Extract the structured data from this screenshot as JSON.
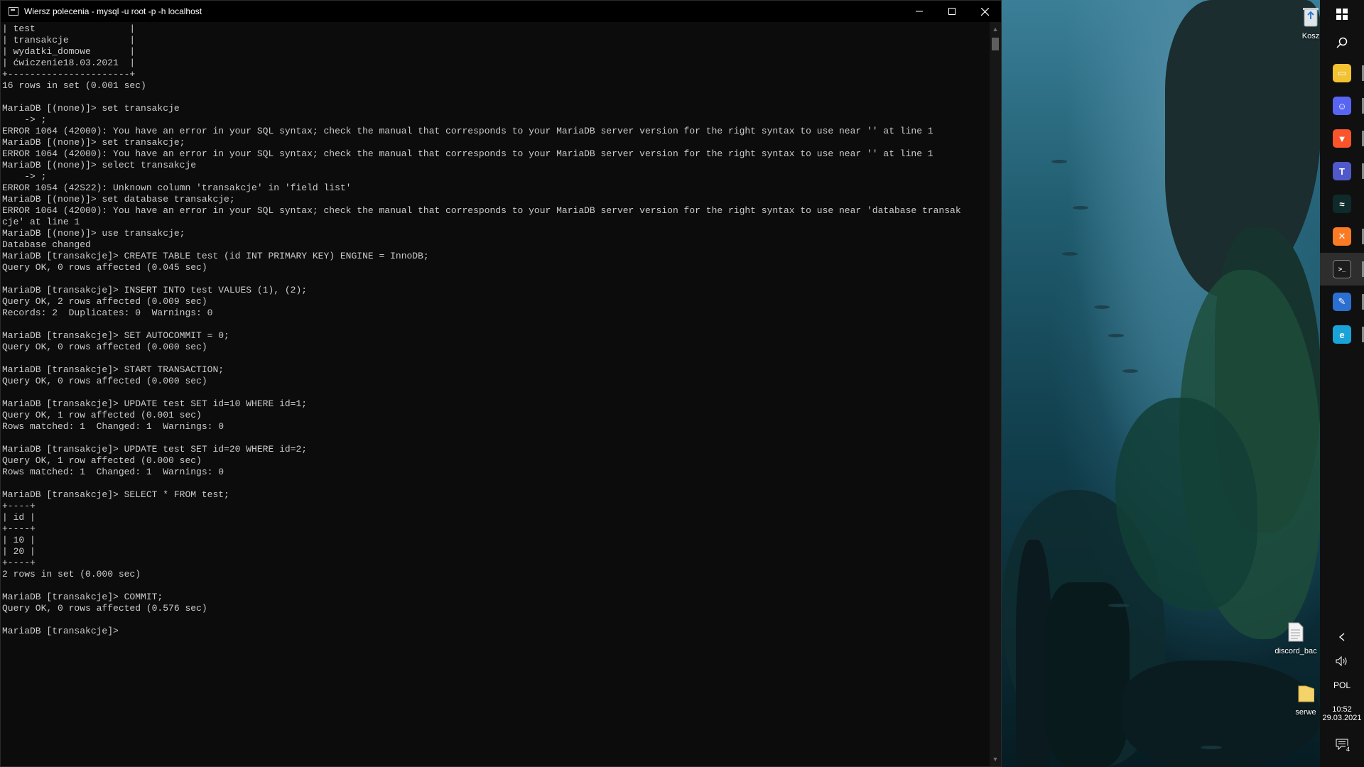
{
  "window": {
    "title": "Wiersz polecenia - mysql  -u root -p -h localhost",
    "minimize_icon": "minimize-icon",
    "maximize_icon": "maximize-icon",
    "close_icon": "close-icon"
  },
  "console": {
    "lines": [
      "| test                 |",
      "| transakcje           |",
      "| wydatki_domowe       |",
      "| ćwiczenie18.03.2021  |",
      "+----------------------+",
      "16 rows in set (0.001 sec)",
      "",
      "MariaDB [(none)]> set transakcje",
      "    -> ;",
      "ERROR 1064 (42000): You have an error in your SQL syntax; check the manual that corresponds to your MariaDB server version for the right syntax to use near '' at line 1",
      "MariaDB [(none)]> set transakcje;",
      "ERROR 1064 (42000): You have an error in your SQL syntax; check the manual that corresponds to your MariaDB server version for the right syntax to use near '' at line 1",
      "MariaDB [(none)]> select transakcje",
      "    -> ;",
      "ERROR 1054 (42S22): Unknown column 'transakcje' in 'field list'",
      "MariaDB [(none)]> set database transakcje;",
      "ERROR 1064 (42000): You have an error in your SQL syntax; check the manual that corresponds to your MariaDB server version for the right syntax to use near 'database transak",
      "cje' at line 1",
      "MariaDB [(none)]> use transakcje;",
      "Database changed",
      "MariaDB [transakcje]> CREATE TABLE test (id INT PRIMARY KEY) ENGINE = InnoDB;",
      "Query OK, 0 rows affected (0.045 sec)",
      "",
      "MariaDB [transakcje]> INSERT INTO test VALUES (1), (2);",
      "Query OK, 2 rows affected (0.009 sec)",
      "Records: 2  Duplicates: 0  Warnings: 0",
      "",
      "MariaDB [transakcje]> SET AUTOCOMMIT = 0;",
      "Query OK, 0 rows affected (0.000 sec)",
      "",
      "MariaDB [transakcje]> START TRANSACTION;",
      "Query OK, 0 rows affected (0.000 sec)",
      "",
      "MariaDB [transakcje]> UPDATE test SET id=10 WHERE id=1;",
      "Query OK, 1 row affected (0.001 sec)",
      "Rows matched: 1  Changed: 1  Warnings: 0",
      "",
      "MariaDB [transakcje]> UPDATE test SET id=20 WHERE id=2;",
      "Query OK, 1 row affected (0.000 sec)",
      "Rows matched: 1  Changed: 1  Warnings: 0",
      "",
      "MariaDB [transakcje]> SELECT * FROM test;",
      "+----+",
      "| id |",
      "+----+",
      "| 10 |",
      "| 20 |",
      "+----+",
      "2 rows in set (0.000 sec)",
      "",
      "MariaDB [transakcje]> COMMIT;",
      "Query OK, 0 rows affected (0.576 sec)",
      "",
      "MariaDB [transakcje]> "
    ]
  },
  "desktop": {
    "icons": [
      {
        "label": "Kosz",
        "icon": "recycle-bin-icon"
      },
      {
        "label": "discord_bac",
        "icon": "text-file-icon"
      },
      {
        "label": "serwe",
        "icon": "folder-icon"
      }
    ]
  },
  "taskbar": {
    "start_icon": "windows-start-icon",
    "search_icon": "search-icon",
    "apps": [
      {
        "name": "file-explorer-icon",
        "color": "#f2c233",
        "glyph": "▭"
      },
      {
        "name": "discord-icon",
        "color": "#5865f2",
        "glyph": "☺"
      },
      {
        "name": "brave-browser-icon",
        "color": "#fb542b",
        "glyph": "▼"
      },
      {
        "name": "teams-icon",
        "color": "#5059c9",
        "glyph": "T"
      },
      {
        "name": "app-wave-icon",
        "color": "#0f2a2a",
        "glyph": "≈"
      },
      {
        "name": "xampp-icon",
        "color": "#fb7a24",
        "glyph": "✕"
      },
      {
        "name": "command-prompt-icon",
        "color": "#1c1c1c",
        "glyph": ">_"
      },
      {
        "name": "paint-icon",
        "color": "#2b6fd1",
        "glyph": "✎"
      },
      {
        "name": "edge-browser-icon",
        "color": "#1aa3d9",
        "glyph": "e"
      }
    ],
    "tray": {
      "chevron_icon": "chevron-left-icon",
      "volume_icon": "volume-icon",
      "language": "POL",
      "time": "10:52",
      "date": "29.03.2021",
      "notification_icon": "notification-icon",
      "notification_count": "4"
    }
  },
  "colors": {
    "console_bg": "#0c0c0c",
    "console_text": "#cccccc",
    "taskbar_bg": "#101010"
  }
}
